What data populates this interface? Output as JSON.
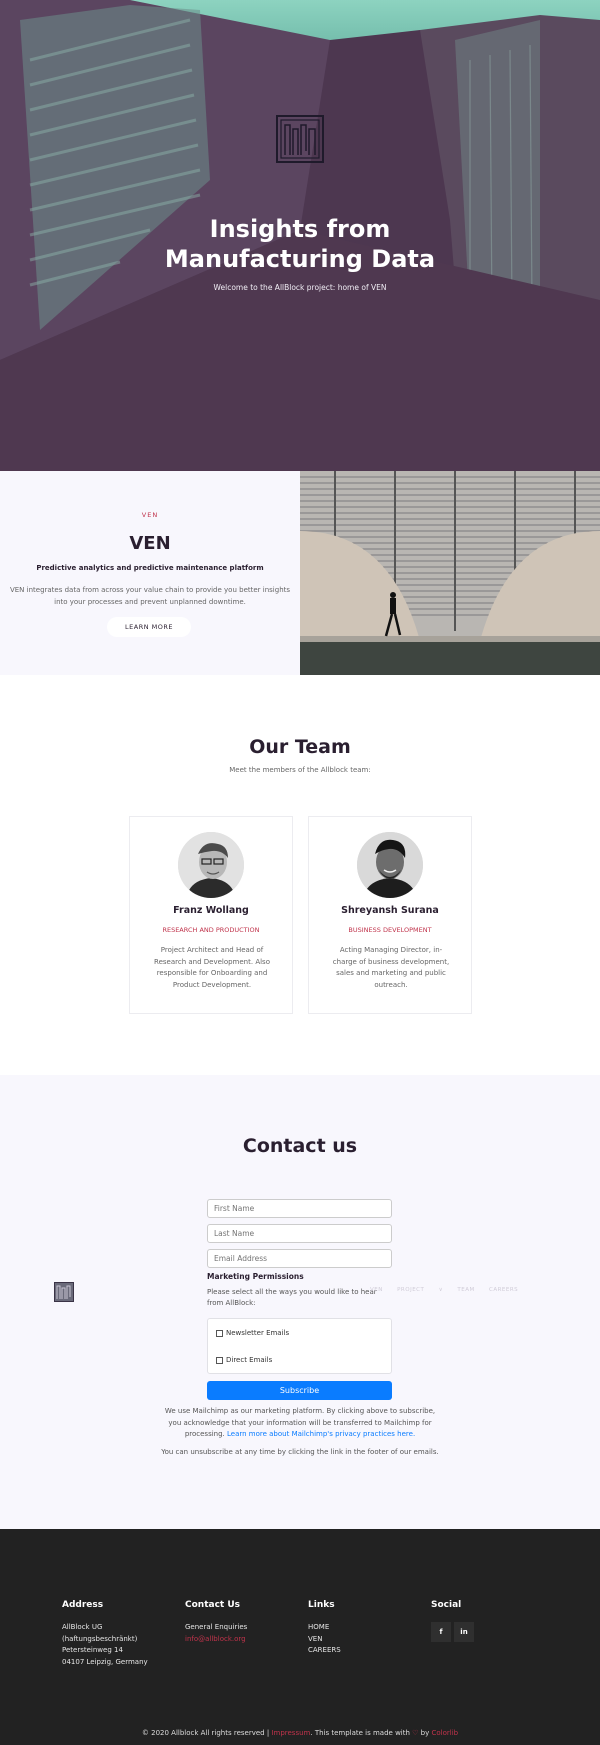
{
  "hero": {
    "title_line1": "Insights from",
    "title_line2": "Manufacturing Data",
    "subtitle": "Welcome to the AllBlock project: home of VEN"
  },
  "ven": {
    "eyebrow": "VEN",
    "title": "VEN",
    "tagline": "Predictive analytics and predictive maintenance platform",
    "description": "VEN integrates data from across your value chain to provide you better insights into your processes and prevent unplanned downtime.",
    "button": "LEARN MORE"
  },
  "team": {
    "title": "Our Team",
    "subtitle": "Meet the members of the Allblock team:",
    "members": [
      {
        "name": "Franz Wollang",
        "role": "RESEARCH AND PRODUCTION",
        "bio": "Project Architect and Head of Research and Development. Also responsible for Onboarding and Product Development."
      },
      {
        "name": "Shreyansh Surana",
        "role": "BUSINESS DEVELOPMENT",
        "bio": "Acting Managing Director, in-charge of business development, sales and marketing and public outreach."
      }
    ]
  },
  "contact": {
    "title": "Contact us",
    "first_name_placeholder": "First Name",
    "last_name_placeholder": "Last Name",
    "email_placeholder": "Email Address",
    "permissions_title": "Marketing Permissions",
    "permissions_text": "Please select all the ways you would like to hear from AllBlock:",
    "option_newsletter": "Newsletter Emails",
    "option_direct": "Direct Emails",
    "subscribe": "Subscribe",
    "legal_text": "We use Mailchimp as our marketing platform. By clicking above to subscribe, you acknowledge that your information will be transferred to Mailchimp for processing.",
    "legal_link": "Learn more about Mailchimp's privacy practices here.",
    "unsubscribe": "You can unsubscribe at any time by clicking the link in the footer of our emails.",
    "ghost_nav": "VEN PROJECT ∨ TEAM CAREERS"
  },
  "footer": {
    "address_title": "Address",
    "address_lines": [
      "AllBlock UG",
      "(haftungsbeschränkt)",
      "Petersteinweg 14",
      "04107 Leipzig, Germany"
    ],
    "contact_title": "Contact Us",
    "contact_line": "General Enquiries",
    "contact_email": "info@allblock.org",
    "links_title": "Links",
    "links": [
      "HOME",
      "VEN",
      "CAREERS"
    ],
    "social_title": "Social",
    "social": [
      "f",
      "in"
    ],
    "copyright": "© 2020 Allblock All rights reserved |",
    "copy_link": "Impressum",
    "copy_mid": "This template is made with",
    "copy_heart": "♡",
    "copy_by": "by",
    "copy_author": "Colorlib"
  },
  "colors": {
    "accent": "#c0334b",
    "primary_dark": "#2a1f30",
    "subscribe_blue": "#0a7cff",
    "footer_bg": "#222222",
    "section_bg": "#f8f7fd"
  }
}
